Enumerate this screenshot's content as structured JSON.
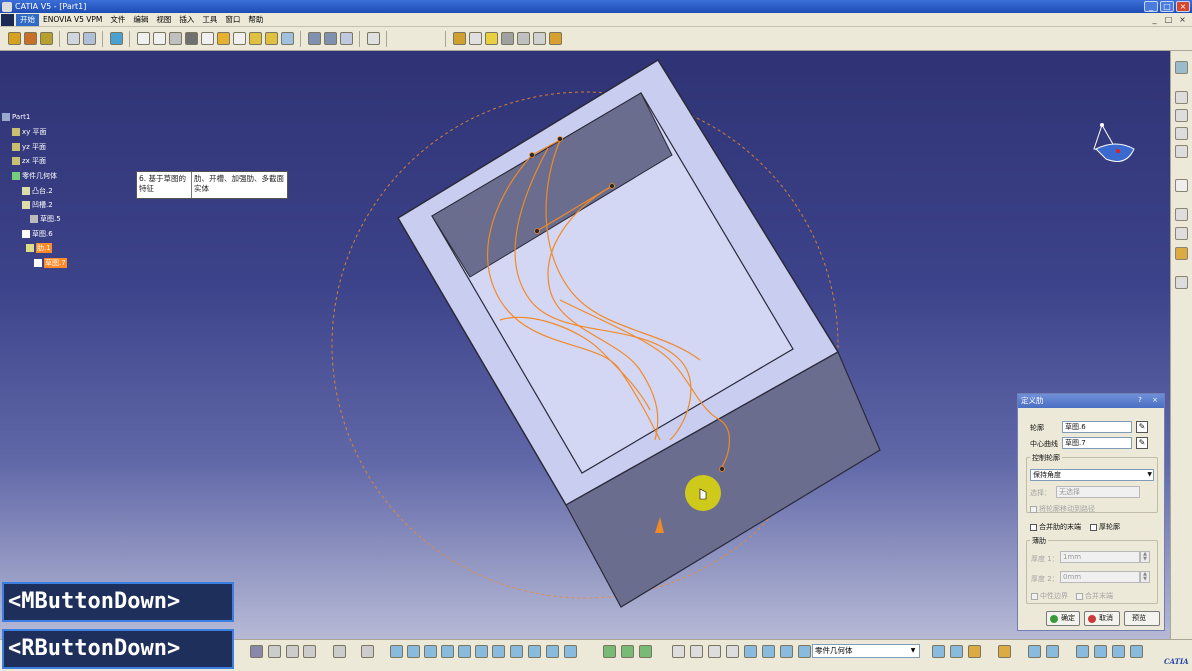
{
  "window": {
    "title": "CATIA V5 - [Part1]"
  },
  "menu": {
    "items": [
      "开始",
      "ENOVIA V5 VPM",
      "文件",
      "编辑",
      "视图",
      "插入",
      "工具",
      "窗口",
      "帮助"
    ],
    "mdi_buttons": [
      "_",
      "□",
      "×"
    ]
  },
  "tree": {
    "root": "Part1",
    "nodes": [
      {
        "label": "xy 平面",
        "icon": "plane-icon"
      },
      {
        "label": "yz 平面",
        "icon": "plane-icon"
      },
      {
        "label": "zx 平面",
        "icon": "plane-icon"
      },
      {
        "label": "零件几何体",
        "icon": "body-icon"
      },
      {
        "label": "凸台.2",
        "icon": "pad-icon"
      },
      {
        "label": "凹槽.2",
        "icon": "pocket-icon"
      },
      {
        "label": "草图.5",
        "icon": "sketch-icon"
      },
      {
        "label": "草图.6",
        "icon": "sketch-icon"
      },
      {
        "label": "肋.1",
        "icon": "rib-icon",
        "selected": true
      },
      {
        "label": "草图.7",
        "icon": "sketch-icon",
        "selected": true
      }
    ]
  },
  "tooltip": {
    "left": "6. 基于草图的特征",
    "right": "肋、开槽、加强肋、多截面实体"
  },
  "key_overlays": [
    "<MButtonDown>",
    "<RButtonDown>"
  ],
  "dialog": {
    "title": "定义肋",
    "help": "?",
    "close": "×",
    "profile_label": "轮廓",
    "profile_value": "草图.6",
    "center_curve_label": "中心曲线",
    "center_curve_value": "草图.7",
    "control_group": "控制轮廓",
    "control_mode": "保持角度",
    "selection_label": "选择：",
    "selection_value": "无选择",
    "move_profile_label": "将轮廓移动到路径",
    "merge_ends_label": "合并肋的末端",
    "thick_profile_label": "厚轮廓",
    "thin_group": "薄肋",
    "thickness1_label": "厚度 1：",
    "thickness1_value": "1mm",
    "thickness2_label": "厚度 2：",
    "thickness2_value": "0mm",
    "neutral_fiber_label": "中性边界",
    "merge_end_label": "合并末端",
    "ok_label": "确定",
    "cancel_label": "取消",
    "preview_label": "预览"
  },
  "bottom_combo": {
    "value": "零件几何体"
  },
  "logo": {
    "text": "CATIA"
  },
  "colors": {
    "viewport_top": "#2f3375",
    "viewport_bottom": "#b7bad6",
    "part_face": "#c9cdf0",
    "pocket_face": "#6a6d8e",
    "sketch_orange": "#f08a28",
    "cursor_highlight": "#e8e000",
    "tree_selection": "#ff8a2a",
    "dialog_title": "#4a6ec2"
  }
}
